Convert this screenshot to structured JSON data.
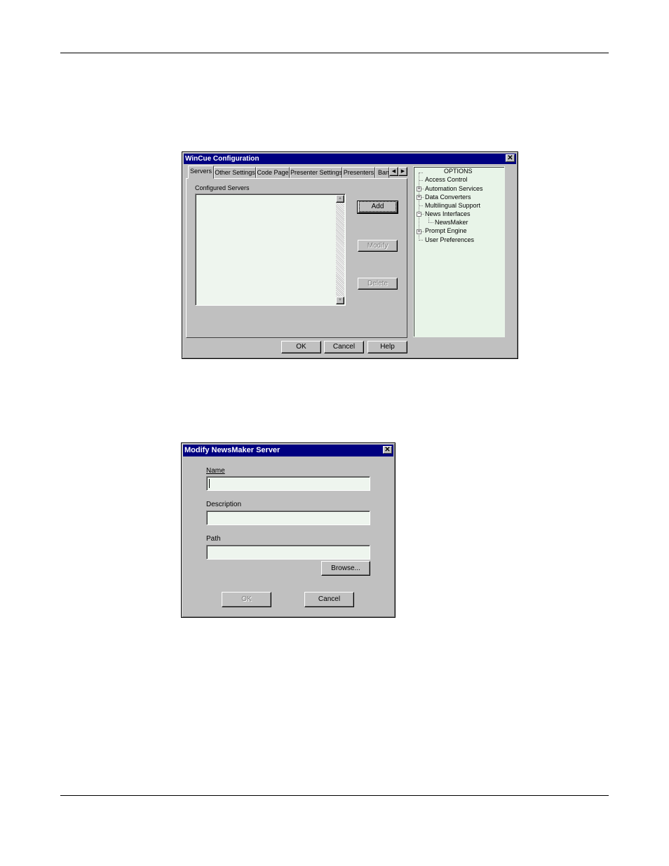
{
  "wincue": {
    "title": "WinCue Configuration",
    "close": "✕",
    "tabs": [
      "Servers",
      "Other Settings",
      "Code Page",
      "Presenter Settings",
      "Presenters",
      "Ban"
    ],
    "tab_scroll_left": "◀",
    "tab_scroll_right": "▶",
    "configured_label": "Configured Servers",
    "add": "Add",
    "modify": "Modify",
    "delete": "Delete",
    "ok": "OK",
    "cancel": "Cancel",
    "help": "Help",
    "scroll_up": "▲",
    "scroll_down": "▼",
    "options": {
      "header": "OPTIONS",
      "items": [
        {
          "label": "Access Control",
          "expand": ""
        },
        {
          "label": "Automation Services",
          "expand": "+"
        },
        {
          "label": "Data Converters",
          "expand": "+"
        },
        {
          "label": "Multilingual Support",
          "expand": ""
        },
        {
          "label": "News Interfaces",
          "expand": "−"
        },
        {
          "label": "NewsMaker",
          "expand": ""
        },
        {
          "label": "Prompt Engine",
          "expand": "+"
        },
        {
          "label": "User Preferences",
          "expand": ""
        }
      ]
    }
  },
  "modify_dialog": {
    "title": "Modify NewsMaker Server",
    "close": "✕",
    "name_label": "Name",
    "name_value": "",
    "description_label": "Description",
    "description_value": "",
    "path_label": "Path",
    "path_value": "",
    "browse": "Browse...",
    "ok": "OK",
    "cancel": "Cancel"
  },
  "colors": {
    "titlebar": "#000080",
    "face": "#c0c0c0",
    "tree_bg": "#e8f4e8",
    "field_bg": "#eef5ee"
  }
}
